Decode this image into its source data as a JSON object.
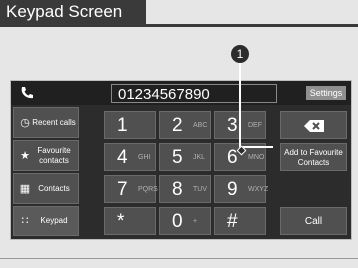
{
  "title": "Keypad Screen",
  "callout_number": "1",
  "topbar": {
    "phone_icon": "phone-icon",
    "number": "01234567890",
    "settings_label": "Settings"
  },
  "side": [
    {
      "icon": "clock-icon",
      "label": "Recent calls"
    },
    {
      "icon": "star-icon",
      "label": "Favourite contacts"
    },
    {
      "icon": "contacts-icon",
      "label": "Contacts"
    },
    {
      "icon": "keypad-icon",
      "label": "Keypad"
    }
  ],
  "keys": [
    {
      "d": "1",
      "l": ""
    },
    {
      "d": "2",
      "l": "ABC"
    },
    {
      "d": "3",
      "l": "DEF"
    },
    {
      "d": "4",
      "l": "GHI"
    },
    {
      "d": "5",
      "l": "JKL"
    },
    {
      "d": "6",
      "l": "MNO"
    },
    {
      "d": "7",
      "l": "PQRS"
    },
    {
      "d": "8",
      "l": "TUV"
    },
    {
      "d": "9",
      "l": "WXYZ"
    },
    {
      "d": "*",
      "l": ""
    },
    {
      "d": "0",
      "l": "+"
    },
    {
      "d": "#",
      "l": ""
    }
  ],
  "actions": {
    "add_favourite": "Add to Favourite Contacts",
    "call": "Call",
    "backspace_icon": "backspace-icon"
  }
}
